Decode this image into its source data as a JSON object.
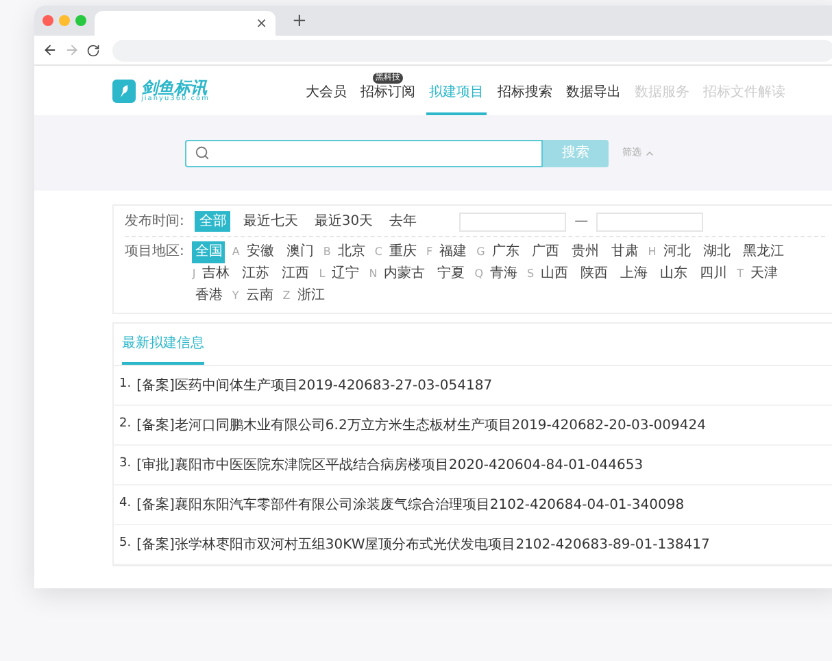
{
  "browser": {
    "tab_close": "×",
    "new_tab": "+"
  },
  "header": {
    "logo_name": "剑鱼标讯",
    "logo_domain": "jianyu360.com",
    "nav": [
      {
        "label": "大会员",
        "selected": false
      },
      {
        "label": "招标订阅",
        "selected": false,
        "badge": "黑科技"
      },
      {
        "label": "拟建项目",
        "selected": true
      },
      {
        "label": "招标搜索",
        "selected": false
      },
      {
        "label": "数据导出",
        "selected": false
      },
      {
        "label": "数据服务",
        "selected": false
      },
      {
        "label": "招标文件解读",
        "selected": false
      }
    ]
  },
  "search": {
    "button": "搜索",
    "filter_toggle": "筛选"
  },
  "filters": {
    "time_label": "发布时间:",
    "time_options": [
      {
        "label": "全部",
        "selected": true
      },
      {
        "label": "最近七天",
        "selected": false
      },
      {
        "label": "最近30天",
        "selected": false
      },
      {
        "label": "去年",
        "selected": false
      }
    ],
    "date_separator": "—",
    "region_label": "项目地区:",
    "regions": [
      [
        {
          "name": "全国",
          "selected": true
        },
        {
          "letter": "A",
          "name": "安徽",
          "selected": false
        },
        {
          "name": "澳门",
          "selected": false
        },
        {
          "letter": "B",
          "name": "北京",
          "selected": false
        },
        {
          "letter": "C",
          "name": "重庆",
          "selected": false
        },
        {
          "letter": "F",
          "name": "福建",
          "selected": false
        },
        {
          "letter": "G",
          "name": "广东",
          "selected": false
        },
        {
          "name": "广西",
          "selected": false
        },
        {
          "name": "贵州",
          "selected": false
        },
        {
          "name": "甘肃",
          "selected": false
        },
        {
          "letter": "H",
          "name": "河北",
          "selected": false
        },
        {
          "name": "湖北",
          "selected": false
        },
        {
          "name": "黑龙江",
          "selected": false
        }
      ],
      [
        {
          "letter": "J",
          "name": "吉林",
          "selected": false
        },
        {
          "name": "江苏",
          "selected": false
        },
        {
          "name": "江西",
          "selected": false
        },
        {
          "letter": "L",
          "name": "辽宁",
          "selected": false
        },
        {
          "letter": "N",
          "name": "内蒙古",
          "selected": false
        },
        {
          "name": "宁夏",
          "selected": false
        },
        {
          "letter": "Q",
          "name": "青海",
          "selected": false
        },
        {
          "letter": "S",
          "name": "山西",
          "selected": false
        },
        {
          "name": "陕西",
          "selected": false
        },
        {
          "name": "上海",
          "selected": false
        },
        {
          "name": "山东",
          "selected": false
        },
        {
          "name": "四川",
          "selected": false
        },
        {
          "letter": "T",
          "name": "天津",
          "selected": false
        }
      ],
      [
        {
          "name": "香港",
          "selected": false
        },
        {
          "letter": "Y",
          "name": "云南",
          "selected": false
        },
        {
          "letter": "Z",
          "name": "浙江",
          "selected": false
        }
      ]
    ]
  },
  "list": {
    "tab": "最新拟建信息",
    "items": [
      {
        "index": "1.",
        "title": "[备案]医药中间体生产项目2019-420683-27-03-054187"
      },
      {
        "index": "2.",
        "title": "[备案]老河口同鹏木业有限公司6.2万立方米生态板材生产项目2019-420682-20-03-009424"
      },
      {
        "index": "3.",
        "title": "[审批]襄阳市中医医院东津院区平战结合病房楼项目2020-420604-84-01-044653"
      },
      {
        "index": "4.",
        "title": "[备案]襄阳东阳汽车零部件有限公司涂装废气综合治理项目2102-420684-04-01-340098"
      },
      {
        "index": "5.",
        "title": "[备案]张学林枣阳市双河村五组30KW屋顶分布式光伏发电项目2102-420683-89-01-138417"
      }
    ]
  }
}
